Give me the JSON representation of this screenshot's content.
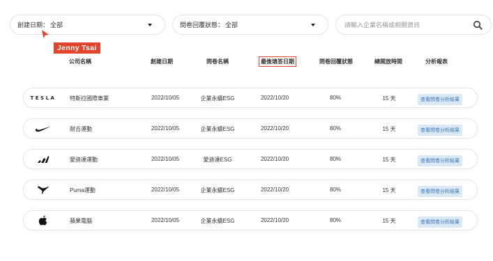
{
  "filters": {
    "created_date": {
      "label": "創建日期：",
      "value": "全部"
    },
    "reply_status": {
      "label": "問卷回覆狀態：",
      "value": "全部"
    },
    "search": {
      "placeholder": "請輸入企業名稱或相關資訊"
    }
  },
  "cursor_tag": "Jenny Tsai",
  "table": {
    "headers": [
      "公司名稱",
      "創建日期",
      "問卷名稱",
      "最後填答日期",
      "問卷回覆狀態",
      "總開放時間",
      "分析報表"
    ],
    "highlighted_header": "最後填答日期",
    "rows": [
      {
        "logo": "tesla-logo",
        "logo_text": "TESLA",
        "company": "特斯拉國際車業",
        "created": "2022/10/05",
        "survey": "企業永續ESG",
        "last_answer": "2022/10/20",
        "status": "80%",
        "duration": "15 天",
        "report": "查看問卷分析結果"
      },
      {
        "logo": "nike-logo",
        "company": "耐吉運動",
        "created": "2022/10/05",
        "survey": "企業永續ESG",
        "last_answer": "2022/10/20",
        "status": "80%",
        "duration": "15 天",
        "report": "查看問卷分析結果"
      },
      {
        "logo": "adidas-logo",
        "company": "愛迪達運動",
        "created": "2022/10/05",
        "survey": "愛迪達ESG",
        "last_answer": "2022/10/20",
        "status": "80%",
        "duration": "15 天",
        "report": "查看問卷分析結果"
      },
      {
        "logo": "puma-logo",
        "company": "Puma運動",
        "created": "2022/10/05",
        "survey": "企業永續ESG",
        "last_answer": "2022/10/20",
        "status": "80%",
        "duration": "15 天",
        "report": "查看問卷分析結果"
      },
      {
        "logo": "apple-logo",
        "company": "蘋果電腦",
        "created": "2022/10/05",
        "survey": "企業永續ESG",
        "last_answer": "2022/10/20",
        "status": "80%",
        "duration": "15 天",
        "report": "查看問卷分析結果"
      }
    ]
  },
  "colors": {
    "accent_red": "#e2452c",
    "button_bg": "#dbe9f7",
    "button_text": "#3a78b8"
  }
}
